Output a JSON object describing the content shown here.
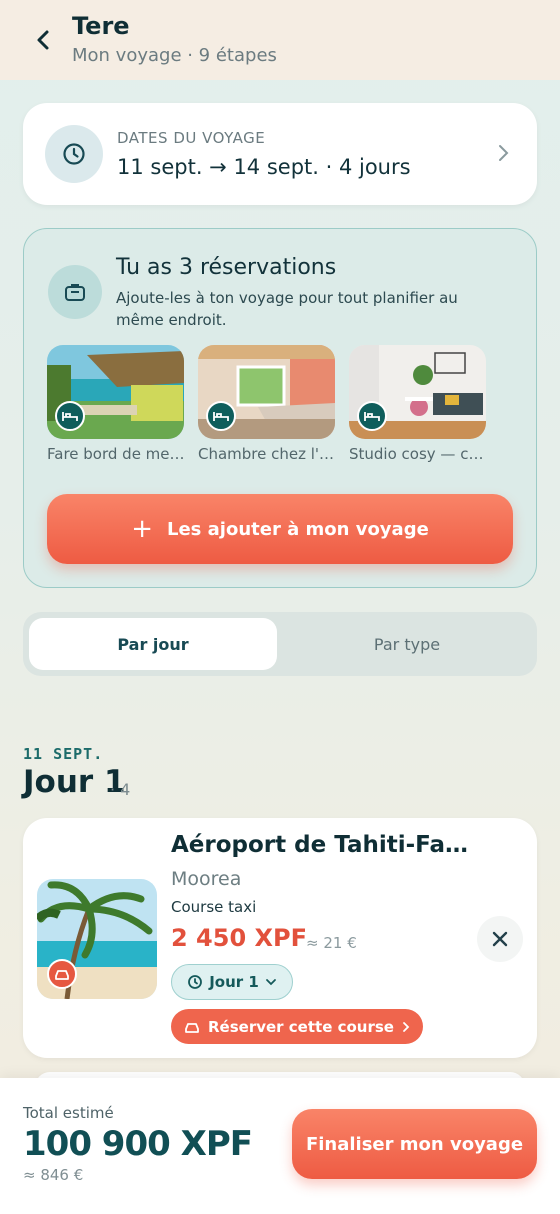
{
  "header": {
    "title": "Tere",
    "subtitle": "Mon voyage · 9 étapes"
  },
  "dates": {
    "label": "DATES DU VOYAGE",
    "value": "11 sept. → 14 sept. · 4 jours"
  },
  "reservations": {
    "title": "Tu as 3 réservations",
    "description": "Ajoute-les à ton voyage pour tout planifier au même endroit.",
    "items": [
      {
        "label": "Fare bord de me…",
        "icon": "bed-icon"
      },
      {
        "label": "Chambre chez l'…",
        "icon": "bed-icon"
      },
      {
        "label": "Studio cosy — c…",
        "icon": "bed-icon"
      }
    ],
    "add_button": "Les ajouter à mon voyage"
  },
  "tabs": {
    "by_day": "Par jour",
    "by_type": "Par type"
  },
  "day": {
    "date": "11 SEPT.",
    "title": "Jour 1",
    "count": "· 4"
  },
  "item": {
    "title": "Aéroport de Tahiti-Faa'…",
    "location": "Moorea",
    "type": "Course taxi",
    "price": "2 450 XPF",
    "price_eur": "≈ 21 €",
    "day_chip": "Jour 1",
    "book_button": "Réserver cette course",
    "icon": "car-icon"
  },
  "footer": {
    "total_label": "Total estimé",
    "total_value": "100 900 XPF",
    "total_eur": "≈ 846 €",
    "finalize_button": "Finaliser mon voyage"
  },
  "colors": {
    "accent": "#ee5b43",
    "teal": "#114f55",
    "reservation_bg": "#dcebe8"
  }
}
